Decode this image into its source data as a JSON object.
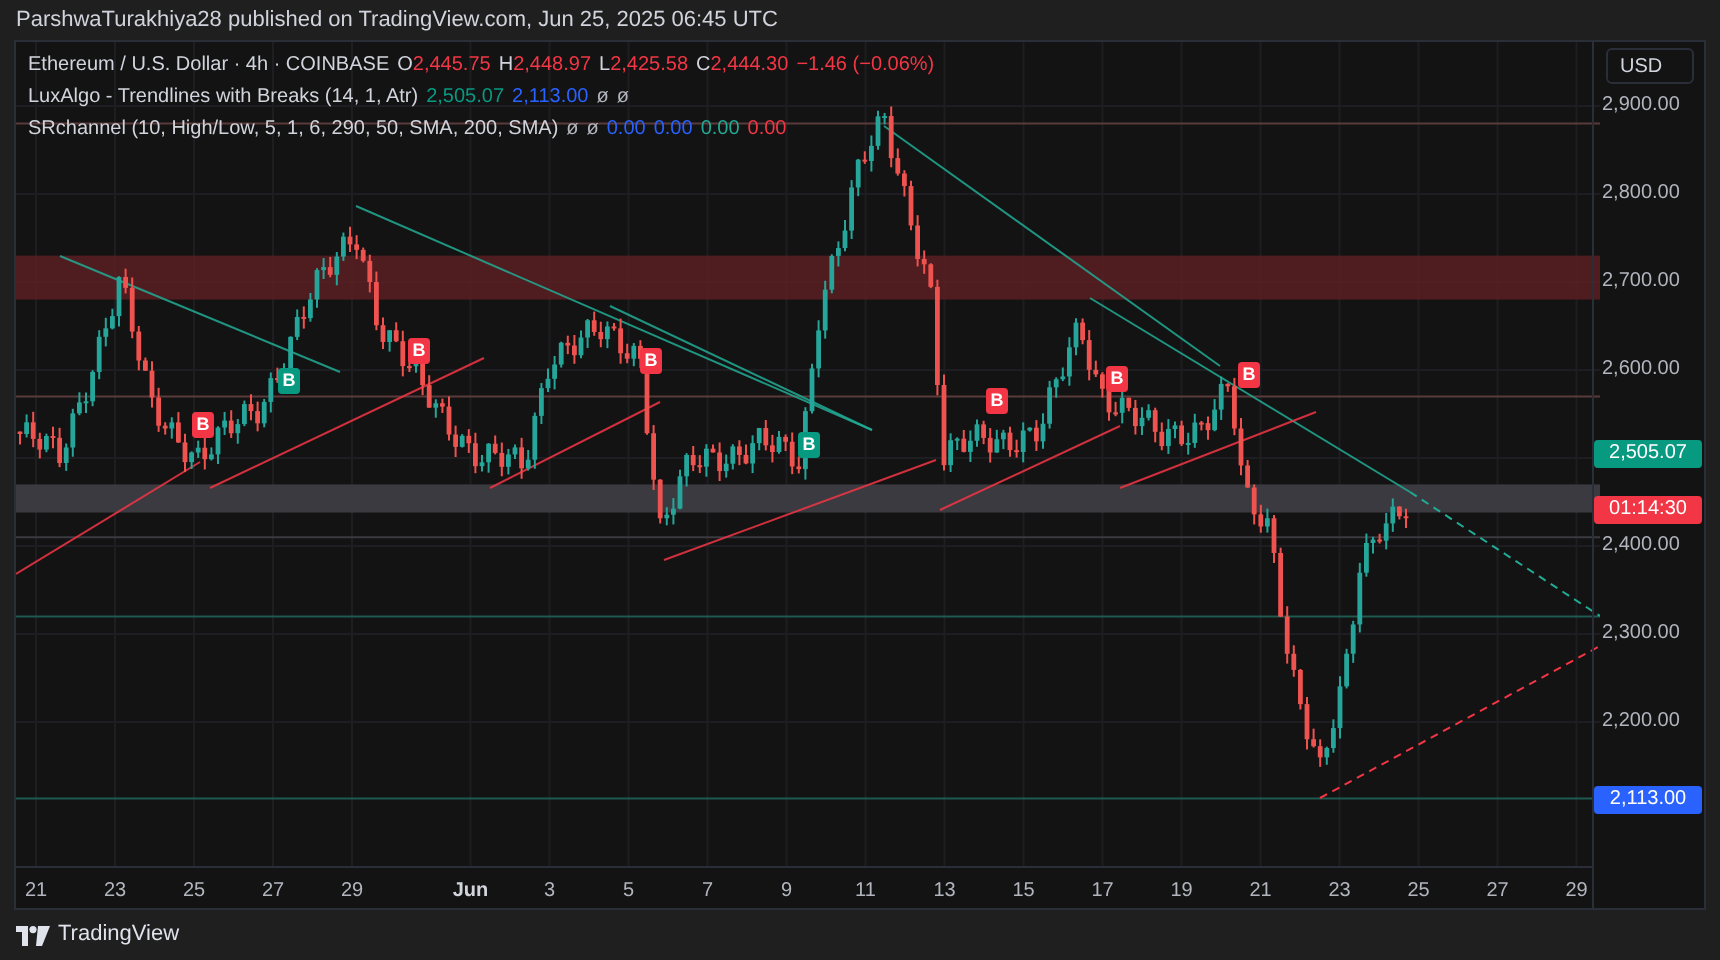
{
  "header": {
    "text": "ParshwaTurakhiya28 published on TradingView.com, Jun 25, 2025 06:45 UTC"
  },
  "legend": [
    {
      "title": "Ethereum / U.S. Dollar · 4h · COINBASE",
      "values": [
        {
          "prefix": "O",
          "text": "2,445.75",
          "color": "#f23645"
        },
        {
          "prefix": "H",
          "text": "2,448.97",
          "color": "#f23645"
        },
        {
          "prefix": "L",
          "text": "2,425.58",
          "color": "#f23645"
        },
        {
          "prefix": "C",
          "text": "2,444.30",
          "color": "#f23645"
        },
        {
          "text": "−1.46 (−0.06%)",
          "color": "#f23645"
        }
      ]
    },
    {
      "title": "LuxAlgo - Trendlines with Breaks (14, 1, Atr)",
      "values": [
        {
          "text": "2,505.07",
          "color": "#089981"
        },
        {
          "text": "2,113.00",
          "color": "#2962ff"
        },
        {
          "text": "ø",
          "color": "#b2b5be"
        },
        {
          "text": "ø",
          "color": "#b2b5be"
        }
      ]
    },
    {
      "title": "SRchannel (10, High/Low, 5, 1, 6, 290, 50, SMA, 200, SMA)",
      "values": [
        {
          "text": "ø",
          "color": "#b2b5be"
        },
        {
          "text": "ø",
          "color": "#b2b5be"
        },
        {
          "text": "0.00",
          "color": "#2962ff"
        },
        {
          "text": "0.00",
          "color": "#2962ff"
        },
        {
          "text": "0.00",
          "color": "#22ab94"
        },
        {
          "text": "0.00",
          "color": "#f23645"
        }
      ]
    }
  ],
  "markers": [
    {
      "text": "B",
      "kind": "down"
    },
    {
      "text": "B",
      "kind": "up"
    },
    {
      "text": "B",
      "kind": "down"
    },
    {
      "text": "B",
      "kind": "down"
    },
    {
      "text": "B",
      "kind": "up"
    },
    {
      "text": "B",
      "kind": "down"
    },
    {
      "text": "B",
      "kind": "down"
    },
    {
      "text": "B",
      "kind": "down"
    }
  ],
  "price_axis": {
    "currency": "USD",
    "ticks": [
      "2,900.00",
      "2,800.00",
      "2,700.00",
      "2,600.00",
      "2,400.00",
      "2,300.00",
      "2,200.00"
    ],
    "tags": [
      {
        "text": "2,505.07",
        "color": "#089981"
      },
      {
        "text": "01:14:30",
        "color": "#f23645"
      },
      {
        "text": "2,113.00",
        "color": "#2962ff"
      }
    ]
  },
  "time_axis": [
    "21",
    "23",
    "25",
    "27",
    "29",
    "Jun",
    "3",
    "5",
    "7",
    "9",
    "11",
    "13",
    "15",
    "17",
    "19",
    "21",
    "23",
    "25",
    "27",
    "29"
  ],
  "footer": {
    "brand": "TradingView"
  }
}
